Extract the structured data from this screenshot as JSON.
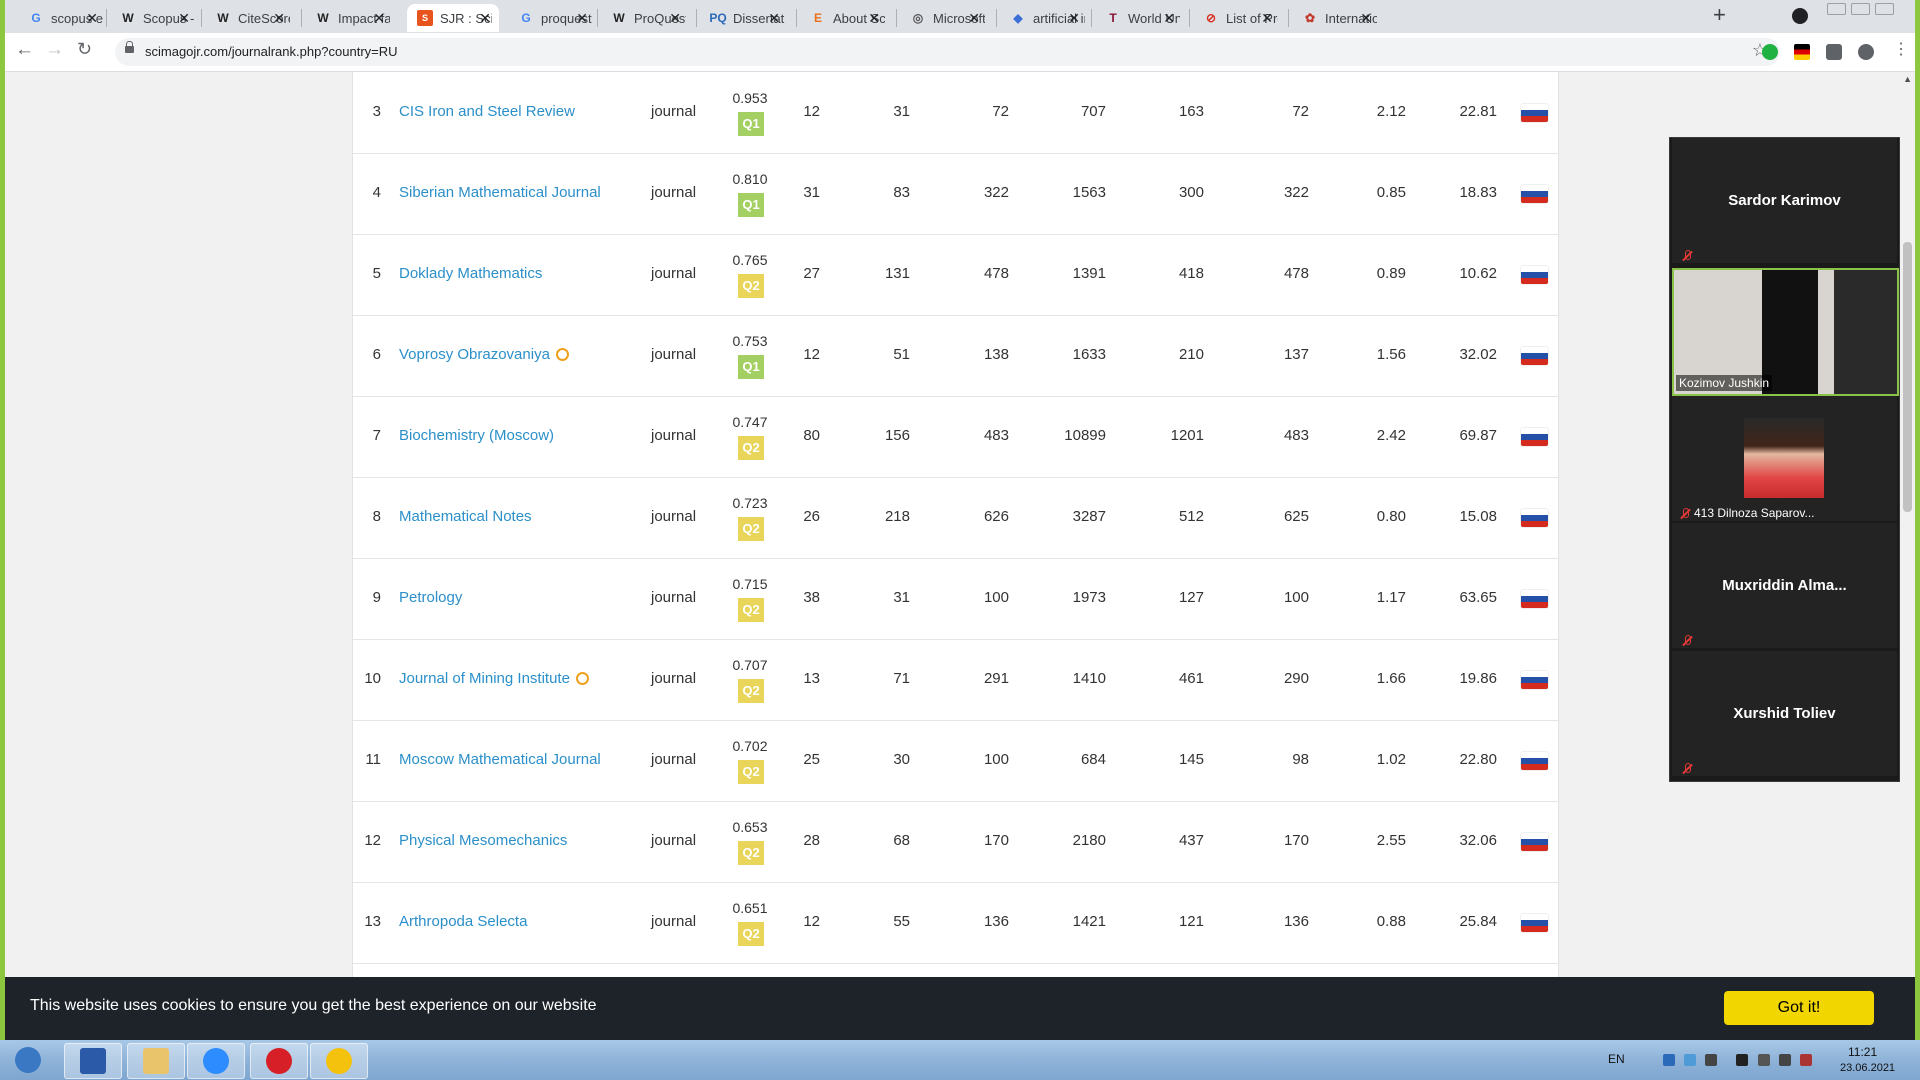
{
  "browser": {
    "tabs": [
      {
        "title": "scopus en",
        "icon": "google-icon",
        "active": false
      },
      {
        "title": "Scopus - W",
        "icon": "wikipedia-icon",
        "active": false
      },
      {
        "title": "CiteScore",
        "icon": "wikipedia-icon",
        "active": false
      },
      {
        "title": "Impact fac",
        "icon": "wikipedia-icon",
        "active": false
      },
      {
        "title": "SJR : Scien",
        "icon": "sjr-icon",
        "active": true
      },
      {
        "title": "proquest",
        "icon": "google-icon",
        "active": false
      },
      {
        "title": "ProQuest",
        "icon": "wikipedia-icon",
        "active": false
      },
      {
        "title": "Dissertatio",
        "icon": "proquest-icon",
        "active": false
      },
      {
        "title": "About Sco",
        "icon": "elsevier-icon",
        "active": false
      },
      {
        "title": "Microsoft",
        "icon": "globe-icon",
        "active": false
      },
      {
        "title": "artificial in",
        "icon": "diamond-icon",
        "active": false
      },
      {
        "title": "World Uni",
        "icon": "the-icon",
        "active": false
      },
      {
        "title": "List of Pre",
        "icon": "blocked-icon",
        "active": false
      },
      {
        "title": "Internatio",
        "icon": "rose-icon",
        "active": false
      }
    ],
    "url": "scimagojr.com/journalrank.php?country=RU"
  },
  "table": {
    "rows": [
      {
        "rank": "3",
        "title": "CIS Iron and Steel Review",
        "oa": false,
        "type": "journal",
        "sjr": "0.953",
        "quartile": "Q1",
        "h_index": "12",
        "docs_year": "31",
        "docs_3y": "72",
        "refs": "707",
        "cites_3y": "163",
        "citable_3y": "72",
        "cites_per_doc": "2.12",
        "ref_per_doc": "22.81"
      },
      {
        "rank": "4",
        "title": "Siberian Mathematical Journal",
        "oa": false,
        "type": "journal",
        "sjr": "0.810",
        "quartile": "Q1",
        "h_index": "31",
        "docs_year": "83",
        "docs_3y": "322",
        "refs": "1563",
        "cites_3y": "300",
        "citable_3y": "322",
        "cites_per_doc": "0.85",
        "ref_per_doc": "18.83"
      },
      {
        "rank": "5",
        "title": "Doklady Mathematics",
        "oa": false,
        "type": "journal",
        "sjr": "0.765",
        "quartile": "Q2",
        "h_index": "27",
        "docs_year": "131",
        "docs_3y": "478",
        "refs": "1391",
        "cites_3y": "418",
        "citable_3y": "478",
        "cites_per_doc": "0.89",
        "ref_per_doc": "10.62"
      },
      {
        "rank": "6",
        "title": "Voprosy Obrazovaniya",
        "oa": true,
        "type": "journal",
        "sjr": "0.753",
        "quartile": "Q1",
        "h_index": "12",
        "docs_year": "51",
        "docs_3y": "138",
        "refs": "1633",
        "cites_3y": "210",
        "citable_3y": "137",
        "cites_per_doc": "1.56",
        "ref_per_doc": "32.02"
      },
      {
        "rank": "7",
        "title": "Biochemistry (Moscow)",
        "oa": false,
        "type": "journal",
        "sjr": "0.747",
        "quartile": "Q2",
        "h_index": "80",
        "docs_year": "156",
        "docs_3y": "483",
        "refs": "10899",
        "cites_3y": "1201",
        "citable_3y": "483",
        "cites_per_doc": "2.42",
        "ref_per_doc": "69.87"
      },
      {
        "rank": "8",
        "title": "Mathematical Notes",
        "oa": false,
        "type": "journal",
        "sjr": "0.723",
        "quartile": "Q2",
        "h_index": "26",
        "docs_year": "218",
        "docs_3y": "626",
        "refs": "3287",
        "cites_3y": "512",
        "citable_3y": "625",
        "cites_per_doc": "0.80",
        "ref_per_doc": "15.08"
      },
      {
        "rank": "9",
        "title": "Petrology",
        "oa": false,
        "type": "journal",
        "sjr": "0.715",
        "quartile": "Q2",
        "h_index": "38",
        "docs_year": "31",
        "docs_3y": "100",
        "refs": "1973",
        "cites_3y": "127",
        "citable_3y": "100",
        "cites_per_doc": "1.17",
        "ref_per_doc": "63.65"
      },
      {
        "rank": "10",
        "title": "Journal of Mining Institute",
        "oa": true,
        "type": "journal",
        "sjr": "0.707",
        "quartile": "Q2",
        "h_index": "13",
        "docs_year": "71",
        "docs_3y": "291",
        "refs": "1410",
        "cites_3y": "461",
        "citable_3y": "290",
        "cites_per_doc": "1.66",
        "ref_per_doc": "19.86"
      },
      {
        "rank": "11",
        "title": "Moscow Mathematical Journal",
        "oa": false,
        "type": "journal",
        "sjr": "0.702",
        "quartile": "Q2",
        "h_index": "25",
        "docs_year": "30",
        "docs_3y": "100",
        "refs": "684",
        "cites_3y": "145",
        "citable_3y": "98",
        "cites_per_doc": "1.02",
        "ref_per_doc": "22.80"
      },
      {
        "rank": "12",
        "title": "Physical Mesomechanics",
        "oa": false,
        "type": "journal",
        "sjr": "0.653",
        "quartile": "Q2",
        "h_index": "28",
        "docs_year": "68",
        "docs_3y": "170",
        "refs": "2180",
        "cites_3y": "437",
        "citable_3y": "170",
        "cites_per_doc": "2.55",
        "ref_per_doc": "32.06"
      },
      {
        "rank": "13",
        "title": "Arthropoda Selecta",
        "oa": false,
        "type": "journal",
        "sjr": "0.651",
        "quartile": "Q2",
        "h_index": "12",
        "docs_year": "55",
        "docs_3y": "136",
        "refs": "1421",
        "cites_3y": "121",
        "citable_3y": "136",
        "cites_per_doc": "0.88",
        "ref_per_doc": "25.84"
      }
    ],
    "quartile_colors": {
      "Q1": "#a4cf63",
      "Q2": "#e8d559"
    },
    "link_color": "#2b8fc9"
  },
  "zoom": {
    "participants": [
      {
        "name": "Sardor Karimov",
        "kind": "name-only",
        "muted": true
      },
      {
        "name": "Kozimov Jushkin",
        "kind": "video",
        "muted": false
      },
      {
        "name": "413 Dilnoza Saparov...",
        "kind": "photo",
        "muted": true
      },
      {
        "name": "Muxriddin  Alma...",
        "kind": "name-only",
        "muted": true
      },
      {
        "name": "Xurshid Toliev",
        "kind": "name-only",
        "muted": true
      }
    ]
  },
  "cookie": {
    "message": "This website uses cookies to ensure you get the best experience on our website",
    "button": "Got it!",
    "button_color": "#f1d600"
  },
  "taskbar": {
    "apps": [
      "windows-start-icon",
      "save-icon",
      "file-explorer-icon",
      "zoom-app-icon",
      "opera-icon",
      "chrome-icon"
    ],
    "language": "EN",
    "time": "11:21",
    "date": "23.06.2021"
  }
}
